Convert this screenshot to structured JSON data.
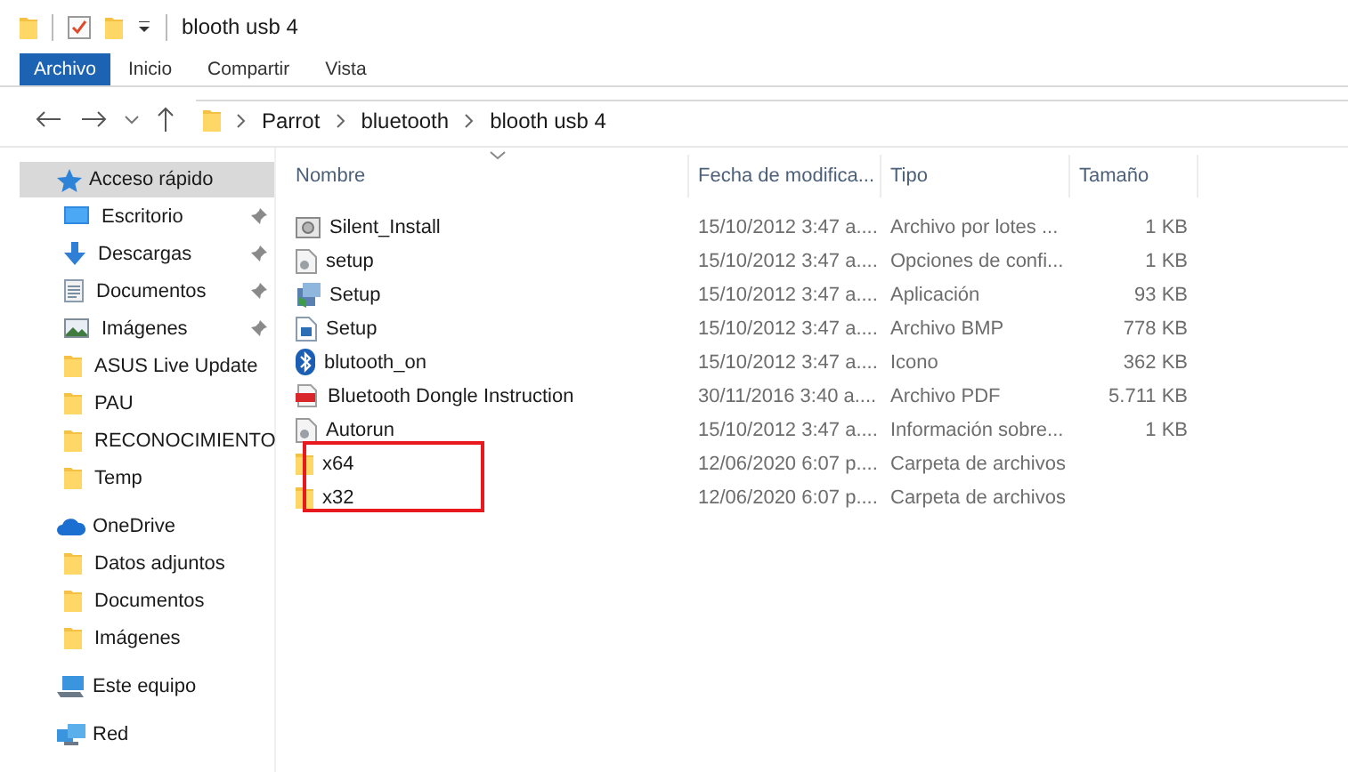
{
  "window": {
    "title": "blooth usb 4"
  },
  "ribbon_tabs": [
    {
      "label": "Archivo",
      "selected": true
    },
    {
      "label": "Inicio",
      "selected": false
    },
    {
      "label": "Compartir",
      "selected": false
    },
    {
      "label": "Vista",
      "selected": false
    }
  ],
  "address_bar": {
    "path": [
      "Parrot",
      "bluetooth",
      "blooth usb 4"
    ]
  },
  "sidebar": {
    "groups": [
      {
        "label": "Acceso rápido",
        "kind": "star",
        "selected": true,
        "children": [
          {
            "label": "Escritorio",
            "kind": "desktop",
            "pinned": true
          },
          {
            "label": "Descargas",
            "kind": "download",
            "pinned": true
          },
          {
            "label": "Documentos",
            "kind": "documents",
            "pinned": true
          },
          {
            "label": "Imágenes",
            "kind": "images",
            "pinned": true
          },
          {
            "label": "ASUS Live Update",
            "kind": "folder",
            "pinned": false
          },
          {
            "label": "PAU",
            "kind": "folder",
            "pinned": false
          },
          {
            "label": "RECONOCIMIENTO",
            "kind": "folder",
            "pinned": false
          },
          {
            "label": "Temp",
            "kind": "folder",
            "pinned": false
          }
        ]
      },
      {
        "label": "OneDrive",
        "kind": "cloud",
        "selected": false,
        "children": [
          {
            "label": "Datos adjuntos",
            "kind": "folder",
            "pinned": false
          },
          {
            "label": "Documentos",
            "kind": "folder",
            "pinned": false
          },
          {
            "label": "Imágenes",
            "kind": "folder",
            "pinned": false
          }
        ]
      },
      {
        "label": "Este equipo",
        "kind": "computer",
        "selected": false
      },
      {
        "label": "Red",
        "kind": "network",
        "selected": false
      }
    ]
  },
  "table": {
    "columns": [
      "Nombre",
      "Fecha de modifica...",
      "Tipo",
      "Tamaño"
    ],
    "rows": [
      {
        "kind": "script",
        "name": "Silent_Install",
        "date": "15/10/2012 3:47 a....",
        "type": "Archivo por lotes ...",
        "size": "1 KB",
        "highlighted": false
      },
      {
        "kind": "config",
        "name": "setup",
        "date": "15/10/2012 3:47 a....",
        "type": "Opciones de confi...",
        "size": "1 KB",
        "highlighted": false
      },
      {
        "kind": "app",
        "name": "Setup",
        "date": "15/10/2012 3:47 a....",
        "type": "Aplicación",
        "size": "93 KB",
        "highlighted": false
      },
      {
        "kind": "image",
        "name": "Setup",
        "date": "15/10/2012 3:47 a....",
        "type": "Archivo BMP",
        "size": "778 KB",
        "highlighted": false
      },
      {
        "kind": "bluetooth",
        "name": "blutooth_on",
        "date": "15/10/2012 3:47 a....",
        "type": "Icono",
        "size": "362 KB",
        "highlighted": false
      },
      {
        "kind": "pdf",
        "name": "Bluetooth Dongle Instruction",
        "date": "30/11/2016 3:40 a....",
        "type": "Archivo PDF",
        "size": "5.711 KB",
        "highlighted": false
      },
      {
        "kind": "config",
        "name": "Autorun",
        "date": "15/10/2012 3:47 a....",
        "type": "Información sobre...",
        "size": "1 KB",
        "highlighted": false
      },
      {
        "kind": "folder",
        "name": "x64",
        "date": "12/06/2020 6:07 p....",
        "type": "Carpeta de archivos",
        "highlighted": true
      },
      {
        "kind": "folder",
        "name": "x32",
        "date": "12/06/2020 6:07 p....",
        "type": "Carpeta de archivos",
        "highlighted": true
      }
    ]
  }
}
